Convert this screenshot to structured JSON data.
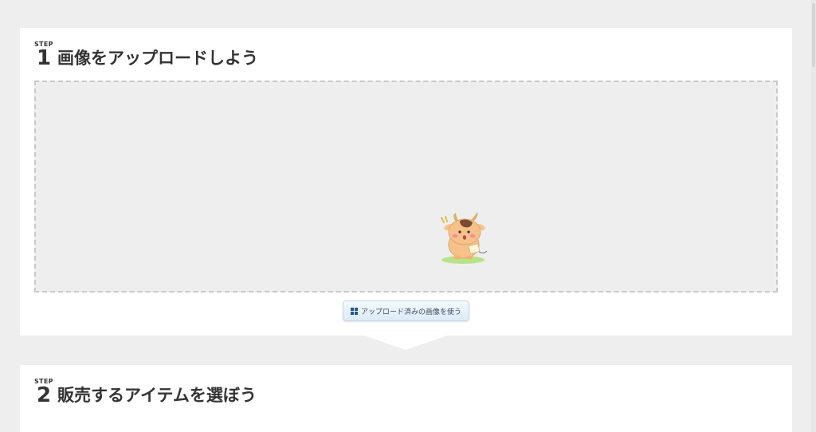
{
  "step1": {
    "step_label": "STEP",
    "number": "1",
    "title": "画像をアップロードしよう"
  },
  "dropzone": {
    "illustration": "cow-mascot-illustration"
  },
  "use_uploaded_button": {
    "icon": "grid-icon",
    "label": "アップロード済みの画像を使う"
  },
  "step2": {
    "step_label": "STEP",
    "number": "2",
    "title": "販売するアイテムを選ぼう"
  },
  "colors": {
    "background": "#eeeeee",
    "card": "#ffffff",
    "dropzone_border": "#c9c9c9",
    "button_icon": "#1f5b86",
    "text": "#333333"
  }
}
